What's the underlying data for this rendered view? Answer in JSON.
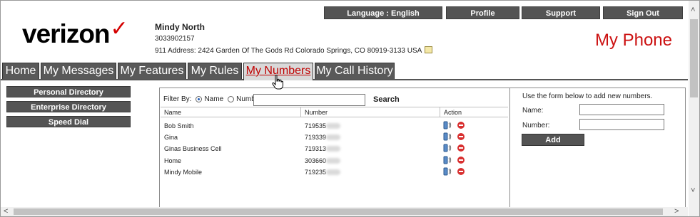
{
  "header": {
    "language_label": "Language : English",
    "profile_label": "Profile",
    "support_label": "Support",
    "signout_label": "Sign Out",
    "logo_text": "verizon",
    "logo_mark": "✓",
    "page_title": "My Phone"
  },
  "account": {
    "name": "Mindy North",
    "number": "3033902157",
    "address": "911 Address: 2424 Garden Of The Gods Rd Colorado Springs, CO 80919-3133 USA"
  },
  "tabs": [
    {
      "label": "Home"
    },
    {
      "label": "My Messages"
    },
    {
      "label": "My Features"
    },
    {
      "label": "My Rules"
    },
    {
      "label": "My Numbers",
      "active": true
    },
    {
      "label": "My Call History"
    }
  ],
  "sidebar": {
    "items": [
      {
        "label": "Personal Directory"
      },
      {
        "label": "Enterprise Directory"
      },
      {
        "label": "Speed Dial"
      }
    ]
  },
  "filter": {
    "label": "Filter By:",
    "option_name": "Name",
    "option_number": "Number",
    "selected": "Name",
    "search_value": "",
    "search_label": "Search"
  },
  "table": {
    "columns": [
      "Name",
      "Number",
      "Action"
    ],
    "rows": [
      {
        "name": "Bob Smith",
        "number": "719535"
      },
      {
        "name": "Gina",
        "number": "719339"
      },
      {
        "name": "Ginas Business Cell",
        "number": "719313"
      },
      {
        "name": "Home",
        "number": "303660"
      },
      {
        "name": "Mindy Mobile",
        "number": "719235"
      }
    ]
  },
  "add_form": {
    "hint": "Use the form below to add new numbers.",
    "name_label": "Name:",
    "name_value": "",
    "number_label": "Number:",
    "number_value": "",
    "add_label": "Add"
  },
  "colors": {
    "brand_red": "#cc1111",
    "button_gray": "#545454",
    "active_tab_bg": "#d9d9d9"
  }
}
